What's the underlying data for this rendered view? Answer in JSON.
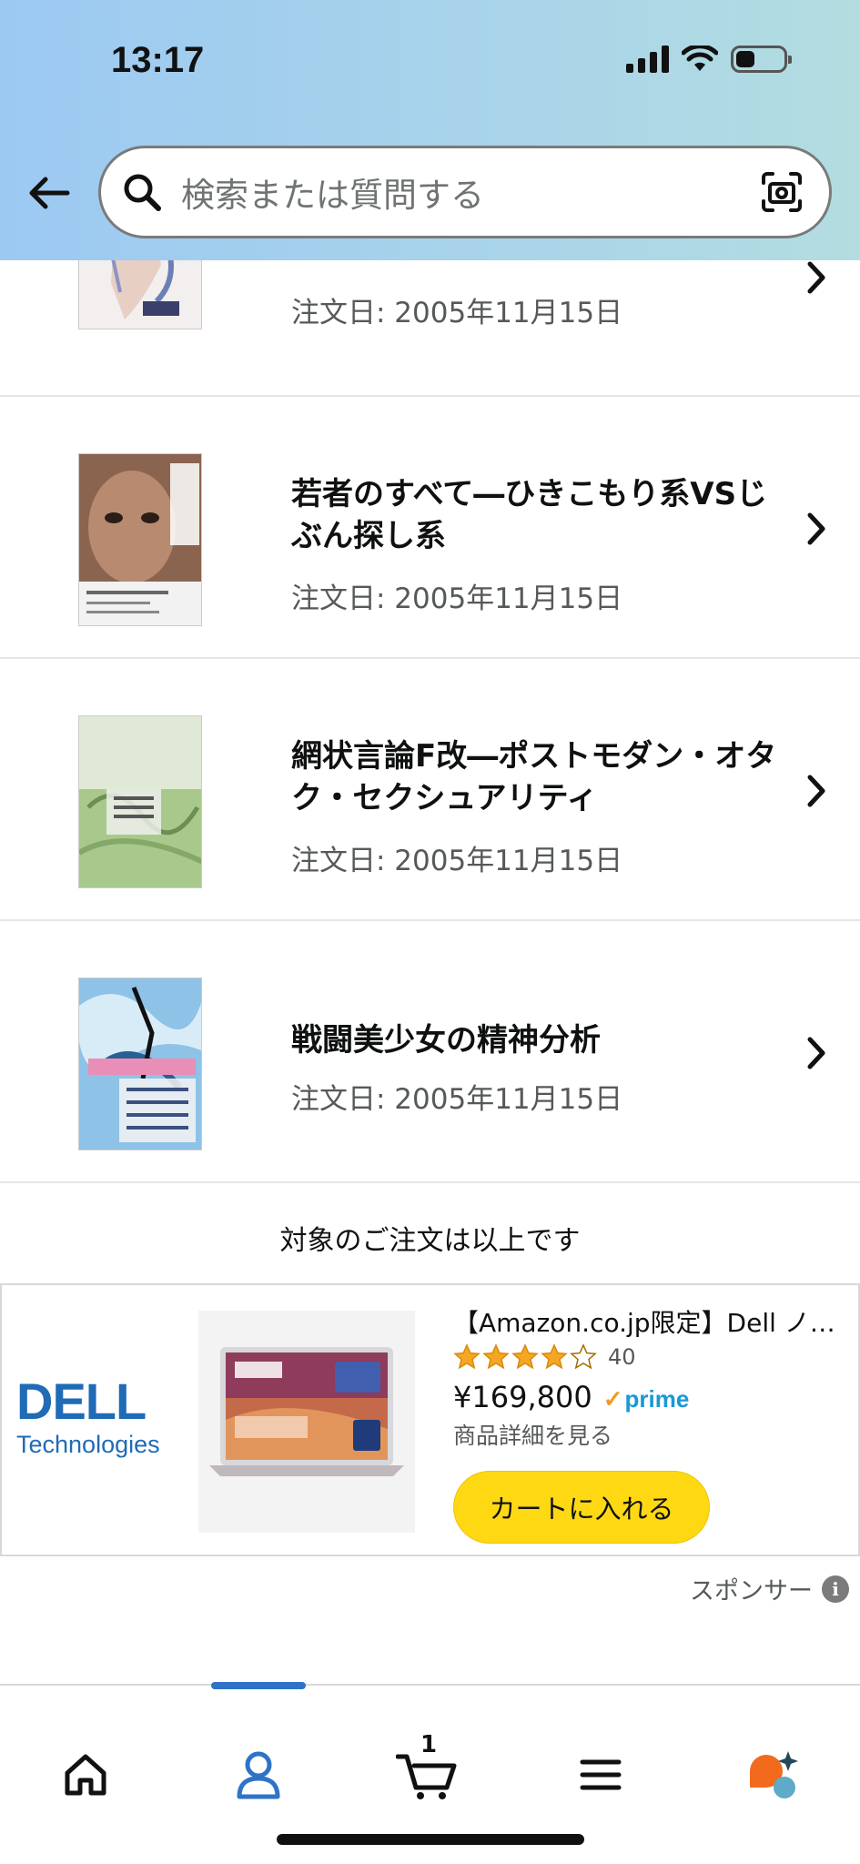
{
  "status_bar": {
    "time": "13:17",
    "battery_level": 0.35
  },
  "search": {
    "placeholder": "検索または質問する"
  },
  "orders": [
    {
      "title": "",
      "date": "注文日: 2005年11月15日"
    },
    {
      "title": "若者のすべて―ひきこもり系VSじぶん探し系",
      "date": "注文日: 2005年11月15日"
    },
    {
      "title": "網状言論F改―ポストモダン・オタク・セクシュアリティ",
      "date": "注文日: 2005年11月15日"
    },
    {
      "title": "戦闘美少女の精神分析",
      "date": "注文日: 2005年11月15日"
    }
  ],
  "end_note": "対象のご注文は以上です",
  "ad": {
    "brand_word": "DELL",
    "brand_sub": "Technologies",
    "title": "【Amazon.co.jp限定】Dell ノート…",
    "rating": 4,
    "rating_count": "40",
    "price": "¥169,800",
    "prime_label": "prime",
    "detail_link": "商品詳細を見る",
    "cart_button": "カートに入れる",
    "sponsor_label": "スポンサー"
  },
  "bottom_nav": {
    "cart_count": "1",
    "active": "account"
  },
  "colors": {
    "accent": "#2e73c7",
    "cart_button": "#ffd814",
    "prime": "#1a98d5"
  }
}
